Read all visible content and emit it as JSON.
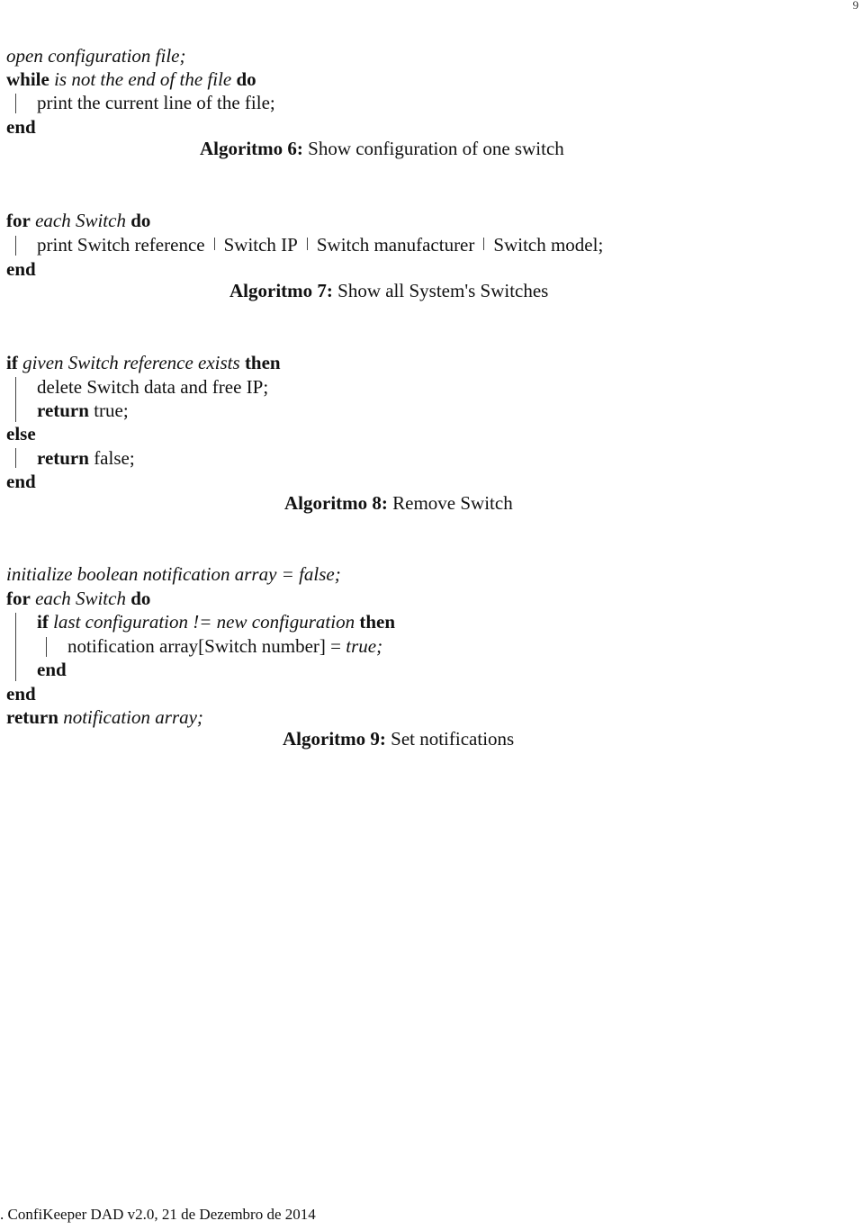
{
  "page_number": "9",
  "algorithms": [
    {
      "caption_label": "Algoritmo 6:",
      "caption_text": "Show configuration of one switch",
      "lines": {
        "l1": "open configuration file;",
        "l2_kw": "while",
        "l2_cond": "is not the end of the file",
        "l2_kw2": "do",
        "l3": "print the current line of the file;",
        "l4": "end"
      }
    },
    {
      "caption_label": "Algoritmo 7:",
      "caption_text": "Show all System's Switches",
      "lines": {
        "l1_kw": "for",
        "l1_cond": "each Switch",
        "l1_kw2": "do",
        "l2_print": "print Switch reference",
        "l2_f2": "Switch IP",
        "l2_f3": "Switch manufacturer",
        "l2_f4": "Switch model;",
        "l3": "end"
      }
    },
    {
      "caption_label": "Algoritmo 8:",
      "caption_text": "Remove Switch",
      "lines": {
        "l1_kw": "if",
        "l1_cond": "given Switch reference exists",
        "l1_kw2": "then",
        "l2": "delete Switch data and free IP;",
        "l3_kw": "return",
        "l3_val": "true;",
        "l4": "else",
        "l5_kw": "return",
        "l5_val": "false;",
        "l6": "end"
      }
    },
    {
      "caption_label": "Algoritmo 9:",
      "caption_text": "Set notifications",
      "lines": {
        "l1": "initialize boolean notification array = false;",
        "l2_kw": "for",
        "l2_cond": "each Switch",
        "l2_kw2": "do",
        "l3_kw": "if",
        "l3_cond": "last configuration != new configuration",
        "l3_kw2": "then",
        "l4_text": "notification array[Switch number] =",
        "l4_val": "true;",
        "l5": "end",
        "l6": "end",
        "l7_kw": "return",
        "l7_val": "notification array;"
      }
    }
  ],
  "footer": ". ConfiKeeper DAD v2.0, 21 de Dezembro de 2014"
}
